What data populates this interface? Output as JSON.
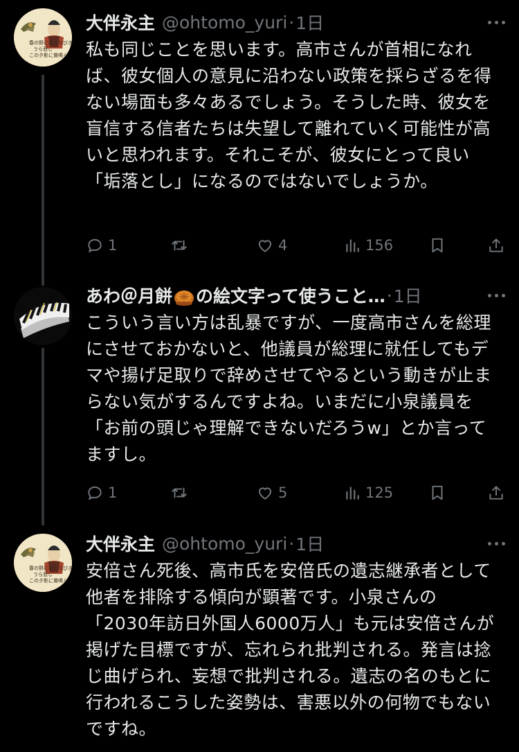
{
  "tweets": [
    {
      "name": "大伴永主",
      "handle": "@ohtomo_yuri",
      "dot": "·",
      "time": "1日",
      "body": "私も同じことを思います。高市さんが首相になれば、彼女個人の意見に沿わない政策を採らざるを得ない場面も多々あるでしょう。そうした時、彼女を盲信する信者たちは失望して離れていく可能性が高いと思われます。それこそが、彼女にとって良い「垢落とし」になるのではないでしょうか。",
      "replies": "1",
      "retweets": "",
      "likes": "4",
      "views": "156",
      "avatar_icon": "poet-portrait-avatar"
    },
    {
      "name_prefix": "あわ＠月餅",
      "name_suffix": "の絵文字って使うこと…",
      "name_emoji": "mooncake-emoji",
      "dot": "·",
      "time": "1日",
      "body": "こういう言い方は乱暴ですが、一度高市さんを総理にさせておかないと、他議員が総理に就任してもデマや揚げ足取りで辞めさせてやるという動きが止まらない気がするんですよね。いまだに小泉議員を「お前の頭じゃ理解できないだろうw」とか言ってますし。",
      "replies": "1",
      "retweets": "",
      "likes": "5",
      "views": "125",
      "avatar_icon": "caterpillar-avatar"
    },
    {
      "name": "大伴永主",
      "handle": "@ohtomo_yuri",
      "dot": "·",
      "time": "1日",
      "body": "安倍さん死後、高市氏を安倍氏の遺志継承者として他者を排除する傾向が顕著です。小泉さんの「2030年訪日外国人6000万人」も元は安倍さんが掲げた目標ですが、忘れられ批判される。発言は捻じ曲げられ、妄想で批判される。遺志の名のもとに行われるこうした姿勢は、害悪以外の何物でもないですね。",
      "avatar_icon": "poet-portrait-avatar"
    }
  ],
  "colors": {
    "background": "#000000",
    "text": "#e7e9ea",
    "muted": "#71767b",
    "thread_line": "#333639"
  },
  "icons": {
    "reply": "reply-icon",
    "retweet": "retweet-icon",
    "like": "heart-icon",
    "views": "views-icon",
    "bookmark": "bookmark-icon",
    "share": "share-icon",
    "more": "more-icon"
  }
}
